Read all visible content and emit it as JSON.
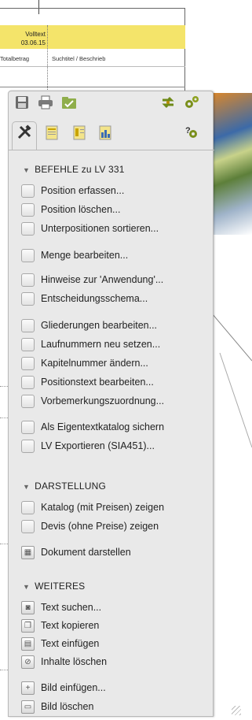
{
  "document": {
    "volltext_label": "Volltext",
    "date": "03.06.15",
    "columns": [
      "Totalbetrag",
      "Suchtitel / Beschrieb"
    ]
  },
  "panel": {
    "tabs": [
      "tools-tab",
      "document-tab",
      "document-list-tab",
      "chart-document-tab"
    ],
    "sections": {
      "befehle": {
        "title": "BEFEHLE zu LV 331",
        "items": [
          "Position erfassen...",
          "Position löschen...",
          "Unterpositionen sortieren...",
          "Menge bearbeiten...",
          "Hinweise zur 'Anwendung'...",
          "Entscheidungsschema...",
          "Gliederungen bearbeiten...",
          "Laufnummern neu setzen...",
          "Kapitelnummer ändern...",
          "Positionstext bearbeiten...",
          "Vorbemerkungszuordnung...",
          "Als Eigentextkatalog sichern",
          "LV Exportieren (SIA451)..."
        ]
      },
      "darstellung": {
        "title": "DARSTELLUNG",
        "items": [
          "Katalog (mit Preisen) zeigen",
          "Devis (ohne Preise) zeigen",
          "Dokument darstellen"
        ]
      },
      "weiteres": {
        "title": "WEITERES",
        "items": [
          "Text suchen...",
          "Text kopieren",
          "Text einfügen",
          "Inhalte löschen",
          "Bild einfügen...",
          "Bild löschen"
        ]
      }
    }
  },
  "colors": {
    "panel_bg": "#e9e9e9",
    "header_yellow": "#f4e46a",
    "gear": "#7a8f1c"
  }
}
